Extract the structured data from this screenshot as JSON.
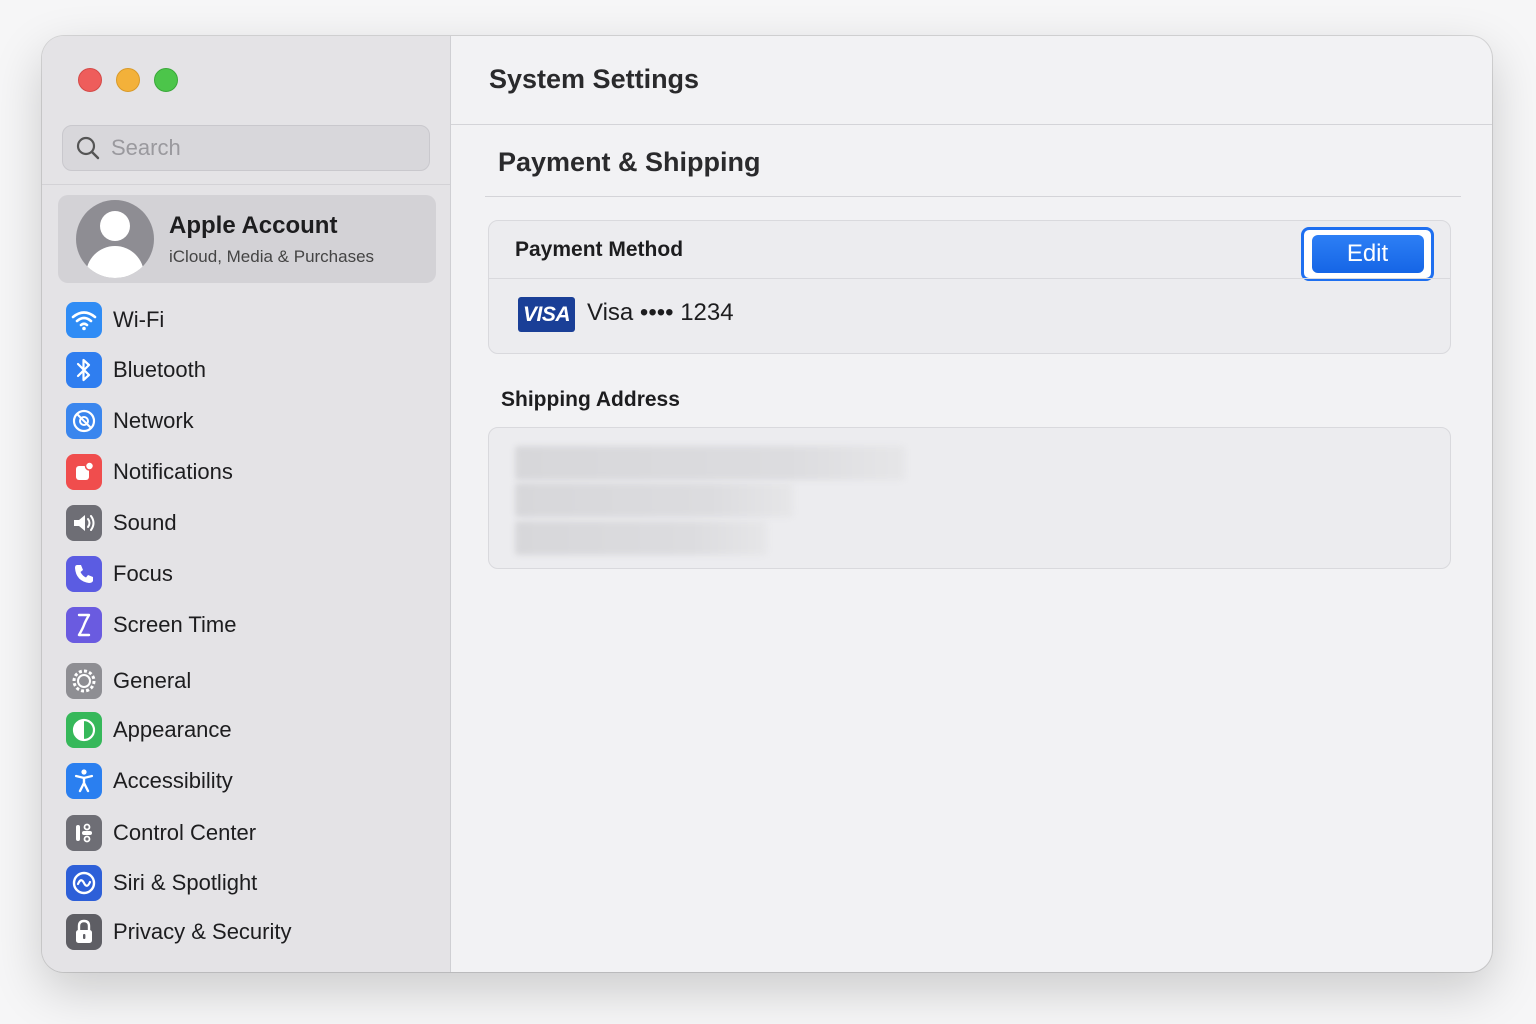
{
  "window": {
    "title": "System Settings"
  },
  "search": {
    "placeholder": "Search"
  },
  "account": {
    "name": "Apple Account",
    "subtitle": "iCloud, Media & Purchases"
  },
  "sidebar": {
    "items": [
      {
        "label": "Wi-Fi",
        "icon": "wifi-icon",
        "color": "#2f8cf5"
      },
      {
        "label": "Bluetooth",
        "icon": "bluetooth-icon",
        "color": "#2f7ef0"
      },
      {
        "label": "Network",
        "icon": "network-icon",
        "color": "#3a86ee"
      },
      {
        "label": "Notifications",
        "icon": "notifications-icon",
        "color": "#f04d4d"
      },
      {
        "label": "Sound",
        "icon": "sound-icon",
        "color": "#6e6e75"
      },
      {
        "label": "Focus",
        "icon": "focus-icon",
        "color": "#5b5ce2"
      },
      {
        "label": "Screen Time",
        "icon": "screen-time-icon",
        "color": "#6a5be0"
      },
      {
        "label": "General",
        "icon": "general-icon",
        "color": "#8e8e93"
      },
      {
        "label": "Appearance",
        "icon": "appearance-icon",
        "color": "#36b85a"
      },
      {
        "label": "Accessibility",
        "icon": "accessibility-icon",
        "color": "#2a7ff0"
      },
      {
        "label": "Control Center",
        "icon": "control-center-icon",
        "color": "#6e6e75"
      },
      {
        "label": "Siri & Spotlight",
        "icon": "siri-icon",
        "color": "#2d5fd8"
      },
      {
        "label": "Privacy & Security",
        "icon": "lock-icon",
        "color": "#5e5e64"
      }
    ]
  },
  "main": {
    "page_title": "Payment & Shipping",
    "payment": {
      "label": "Payment Method",
      "edit_label": "Edit",
      "card_brand": "VISA",
      "card_text": "Visa •••• 1234"
    },
    "shipping": {
      "label": "Shipping Address"
    }
  },
  "colors": {
    "accent": "#1e6ff0",
    "sidebar_bg": "#e4e3e6",
    "main_bg": "#f2f2f4"
  }
}
